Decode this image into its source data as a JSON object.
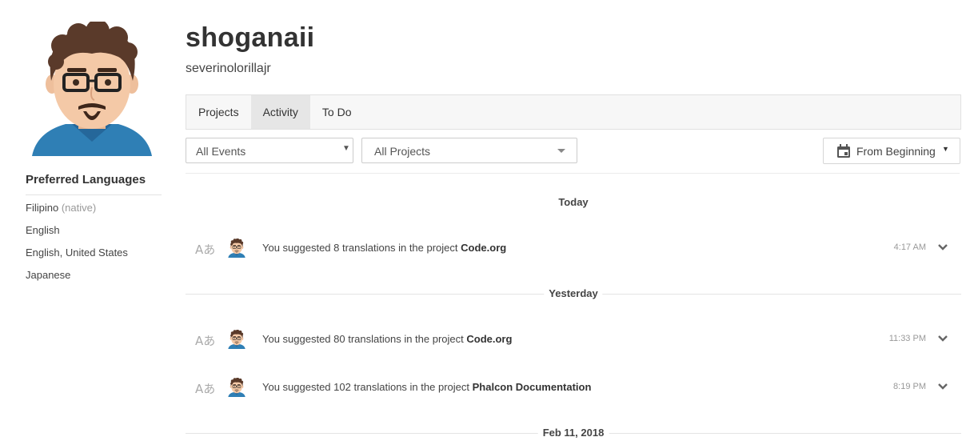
{
  "profile": {
    "display_name": "shoganaii",
    "username": "severinolorillajr",
    "avatar": "cartoon-man-avatar"
  },
  "preferred_languages": {
    "title": "Preferred Languages",
    "items": [
      {
        "name": "Filipino",
        "note": "(native)"
      },
      {
        "name": "English",
        "note": ""
      },
      {
        "name": "English, United States",
        "note": ""
      },
      {
        "name": "Japanese",
        "note": ""
      }
    ]
  },
  "tabs": [
    {
      "label": "Projects",
      "active": false
    },
    {
      "label": "Activity",
      "active": true
    },
    {
      "label": "To Do",
      "active": false
    }
  ],
  "filters": {
    "events": "All Events",
    "projects": "All Projects",
    "date": "From Beginning"
  },
  "activity": {
    "groups": [
      {
        "day": "Today",
        "entries": [
          {
            "prefix": "You suggested 8 translations in the project",
            "project": "Code.org",
            "time": "4:17 AM",
            "icon": "translate-icon"
          }
        ]
      },
      {
        "day": "Yesterday",
        "entries": [
          {
            "prefix": "You suggested 80 translations in the project",
            "project": "Code.org",
            "time": "11:33 PM",
            "icon": "translate-icon"
          },
          {
            "prefix": "You suggested 102 translations in the project",
            "project": "Phalcon Documentation",
            "time": "8:19 PM",
            "icon": "translate-icon"
          }
        ]
      },
      {
        "day": "Feb 11, 2018",
        "entries": []
      }
    ]
  },
  "icons": {
    "translate_glyph": "Aあ"
  },
  "colors": {
    "tab_active_bg": "#e6e6e6",
    "tabs_bg": "#f7f7f7"
  }
}
